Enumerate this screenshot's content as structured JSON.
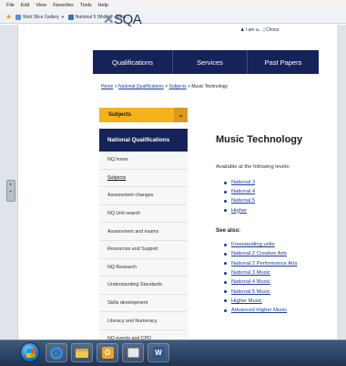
{
  "browser": {
    "menu": [
      "File",
      "Edit",
      "View",
      "Favorites",
      "Tools",
      "Help"
    ],
    "favorites": [
      {
        "label": "Web Slice Gallery",
        "icon": "web-slice-icon",
        "dropdown": true
      },
      {
        "label": "National 5 (Music) - Musi...",
        "icon": "page-icon",
        "dropdown": false
      }
    ]
  },
  "header": {
    "logo_text": "SQA",
    "utility_links": "I am a...  |  Choos"
  },
  "nav": {
    "items": [
      "Qualifications",
      "Services",
      "Past Papers"
    ]
  },
  "breadcrumb": {
    "home": "Home",
    "sep": ">",
    "nq": "National Qualifications",
    "subjects": "Subjects",
    "current": "Music Technology"
  },
  "sidebar": {
    "subjects_label": "Subjects",
    "section_title": "National Qualifications",
    "items": [
      "NQ home",
      "Subjects",
      "Assessment changes",
      "NQ Unit search",
      "Assessment and exams",
      "Resources and Support",
      "NQ Research",
      "Understanding Standards",
      "Skills development",
      "Literacy and Numeracy",
      "NQ events and CPD"
    ]
  },
  "main": {
    "title": "Music Technology",
    "available_text": "Available at the following levels:",
    "levels": [
      "National 3",
      "National 4",
      "National 5",
      "Higher"
    ],
    "see_also_heading": "See also:",
    "see_also": [
      "Freestanding units",
      "National 2 Creative Arts",
      "National 2 Performance Arts",
      "National 3 Music",
      "National 4 Music",
      "National 5 Music",
      "Higher Music",
      "Advanced Higher Music"
    ]
  },
  "taskbar": {
    "word_label": "W",
    "outlook_label": "O",
    "ie_label": "e"
  },
  "colors": {
    "nav_bg": "#16235a",
    "accent_yellow": "#f5b21c",
    "link": "#1a3c9a"
  }
}
